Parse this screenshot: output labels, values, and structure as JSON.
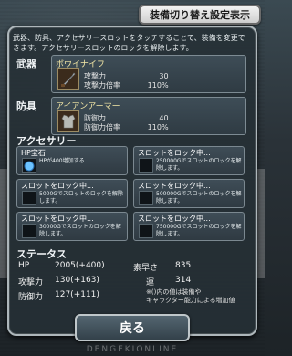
{
  "top_button": {
    "label": "装備切り替え設定表示"
  },
  "description": "武器、防具、アクセサリースロットをタッチすることで、装備を変更できます。アクセサリースロットのロックを解除します。",
  "weapon": {
    "section_title": "武器",
    "name": "ボウイナイフ",
    "stats": [
      {
        "label": "攻撃力",
        "value": "30"
      },
      {
        "label": "攻撃力倍率",
        "value": "110%"
      }
    ]
  },
  "armor": {
    "section_title": "防具",
    "name": "アイアンアーマー",
    "stats": [
      {
        "label": "防御力",
        "value": "40"
      },
      {
        "label": "防御力倍率",
        "value": "110%"
      }
    ]
  },
  "accessory": {
    "section_title": "アクセサリー",
    "slots": [
      {
        "title": "HP宝石",
        "desc": "HPが400増加する"
      },
      {
        "title": "スロットをロック中...",
        "desc": "250000Gでスロットのロックを解除します。"
      },
      {
        "title": "スロットをロック中...",
        "desc": "5000Gでスロットのロックを解除します。"
      },
      {
        "title": "スロットをロック中...",
        "desc": "500000Gでスロットのロックを解除します。"
      },
      {
        "title": "スロットをロック中...",
        "desc": "30000Gでスロットのロックを解除します。"
      },
      {
        "title": "スロットをロック中...",
        "desc": "750000Gでスロットのロックを解除します。"
      }
    ]
  },
  "status": {
    "section_title": "ステータス",
    "hp_label": "HP",
    "hp_value": "2005(+400)",
    "atk_label": "攻撃力",
    "atk_value": "130(+163)",
    "def_label": "防御力",
    "def_value": "127(+111)",
    "agi_label": "素早さ",
    "agi_value": "835",
    "luck_label": "運",
    "luck_value": "314",
    "note_line1": "※()内の値は装備や",
    "note_line2": "キャラクター能力による増加値"
  },
  "back_button": {
    "label": "戻る"
  },
  "watermark": "DENGEKIONLINE"
}
